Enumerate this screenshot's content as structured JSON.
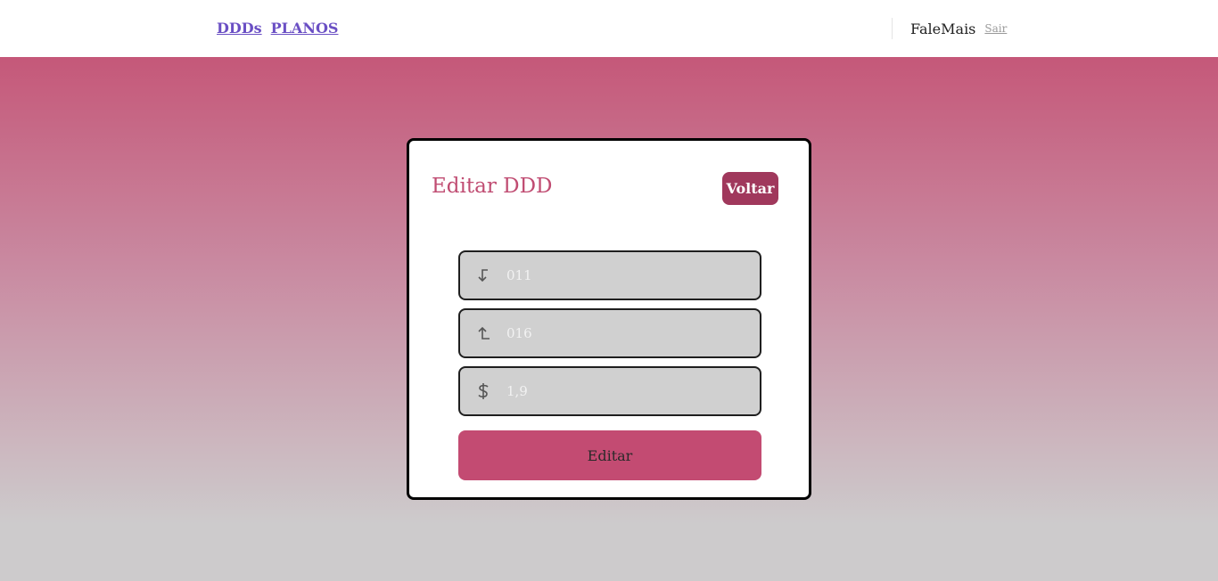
{
  "nav": {
    "links": [
      {
        "label": "DDDs"
      },
      {
        "label": "PLANOS"
      }
    ],
    "brand": "FaleMais",
    "logout_label": "Sair"
  },
  "card": {
    "title": "Editar DDD",
    "back_label": "Voltar",
    "fields": [
      {
        "icon": "arrow-down-left-icon",
        "placeholder": "011"
      },
      {
        "icon": "arrow-up-left-icon",
        "placeholder": "016"
      },
      {
        "icon": "dollar-icon",
        "placeholder": "1,9"
      }
    ],
    "submit_label": "Editar"
  },
  "colors": {
    "accent": "#c34b72",
    "back_button": "#a0385c",
    "nav_link": "#6a4fc4"
  }
}
